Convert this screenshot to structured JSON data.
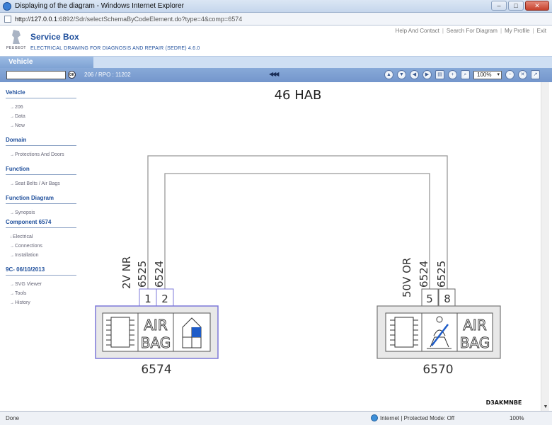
{
  "window": {
    "title": "Displaying of the diagram - Windows Internet Explorer",
    "url_host": "http://127.0.0.1",
    "url_rest": ":6892/Sdr/selectSchemaByCodeElement.do?type=4&comp=6574",
    "min": "–",
    "max": "□",
    "close": "✕"
  },
  "header": {
    "brand": "PEUGEOT",
    "title": "Service Box",
    "subtitle": "ELECTRICAL DRAWING FOR DIAGNOSIS AND REPAIR (SEDRE) 4.6.0",
    "links": [
      "Help And Contact",
      "Search For Diagram",
      "My Profile",
      "Exit"
    ]
  },
  "tabs": {
    "vehicle": "Vehicle"
  },
  "toolbar": {
    "ok": "OK",
    "breadcrumb": "206  /  RPO : 11202",
    "nav": "◀◀◀",
    "zoom": "100%"
  },
  "sidebar": {
    "sections": [
      {
        "title": "Vehicle",
        "items": [
          "206",
          "Data",
          "New"
        ]
      },
      {
        "title": "Domain",
        "items": [
          "Protections And Doors"
        ]
      },
      {
        "title": "Function",
        "items": [
          "Seat Belts / Air Bags"
        ]
      },
      {
        "title": "Function Diagram",
        "items": [
          "Synopsis"
        ]
      },
      {
        "title": "Component 6574",
        "items": [
          "Electrical",
          "Connections",
          "Installation"
        ]
      },
      {
        "title": "9C- 06/10/2013",
        "items": [
          "SVG Viewer",
          "Tools",
          "History"
        ]
      }
    ]
  },
  "diagram": {
    "title": "46 HAB",
    "left_component": {
      "id": "6574",
      "connector_label": "2V NR",
      "wires": [
        "6525",
        "6524"
      ],
      "pins": [
        "1",
        "2"
      ],
      "symbol_text": [
        "AIR",
        "BAG"
      ]
    },
    "right_component": {
      "id": "6570",
      "connector_label": "50V OR",
      "wires": [
        "6524",
        "6525"
      ],
      "pins": [
        "5",
        "8"
      ],
      "symbol_text": [
        "AIR",
        "BAG"
      ]
    },
    "watermark": "D3AKMNBE",
    "colors": {
      "highlight": "#7d79d9",
      "fill_blue": "#1e5cc8",
      "wire": "#999999"
    }
  },
  "status": {
    "left": "Done",
    "zone": "Internet | Protected Mode: Off",
    "zoom": "100%"
  }
}
